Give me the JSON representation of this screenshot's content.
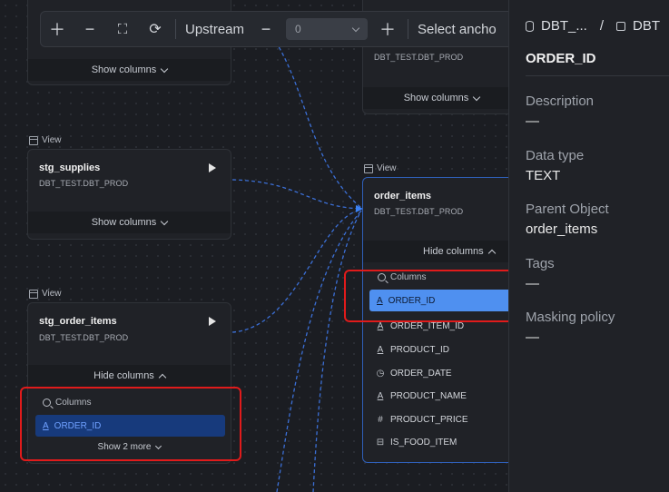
{
  "toolbar": {
    "upstream_label": "Upstream",
    "depth_value": "0",
    "anchor_label": "Select ancho"
  },
  "nodes": {
    "top_left": {
      "show_columns": "Show columns"
    },
    "top_right": {
      "schema": "DBT_TEST.DBT_PROD",
      "show_columns": "Show columns"
    },
    "stg_supplies": {
      "type_label": "View",
      "title": "stg_supplies",
      "schema": "DBT_TEST.DBT_PROD",
      "show_columns": "Show columns"
    },
    "stg_order_items": {
      "type_label": "View",
      "title": "stg_order_items",
      "schema": "DBT_TEST.DBT_PROD",
      "hide_columns": "Hide columns",
      "search_placeholder": "Columns",
      "columns": [
        {
          "name": "ORDER_ID",
          "icon": "text-type-icon"
        }
      ],
      "show_more": "Show 2 more"
    },
    "order_items": {
      "type_label": "View",
      "title": "order_items",
      "schema": "DBT_TEST.DBT_PROD",
      "hide_columns": "Hide columns",
      "search_placeholder": "Columns",
      "columns": [
        {
          "name": "ORDER_ID",
          "icon": "text-type-icon",
          "glyph": "A"
        },
        {
          "name": "ORDER_ITEM_ID",
          "icon": "text-type-icon",
          "glyph": "A"
        },
        {
          "name": "PRODUCT_ID",
          "icon": "text-type-icon",
          "glyph": "A"
        },
        {
          "name": "ORDER_DATE",
          "icon": "clock-icon",
          "glyph": "◷"
        },
        {
          "name": "PRODUCT_NAME",
          "icon": "text-type-icon",
          "glyph": "A"
        },
        {
          "name": "PRODUCT_PRICE",
          "icon": "hash-icon",
          "glyph": "#"
        },
        {
          "name": "IS_FOOD_ITEM",
          "icon": "boolean-icon",
          "glyph": "⊟"
        }
      ]
    }
  },
  "panel": {
    "breadcrumb_db": "DBT_...",
    "breadcrumb_sep": "/",
    "breadcrumb_schema": "DBT",
    "title": "ORDER_ID",
    "description_label": "Description",
    "description_value": "—",
    "datatype_label": "Data type",
    "datatype_value": "TEXT",
    "parent_label": "Parent Object",
    "parent_value": "order_items",
    "tags_label": "Tags",
    "tags_value": "—",
    "masking_label": "Masking policy",
    "masking_value": "—"
  },
  "colors": {
    "accent": "#3b82f6",
    "highlight_row": "#4f90f0",
    "selected_row_dark": "#173a7c",
    "annotation_red": "#e01b1b"
  }
}
